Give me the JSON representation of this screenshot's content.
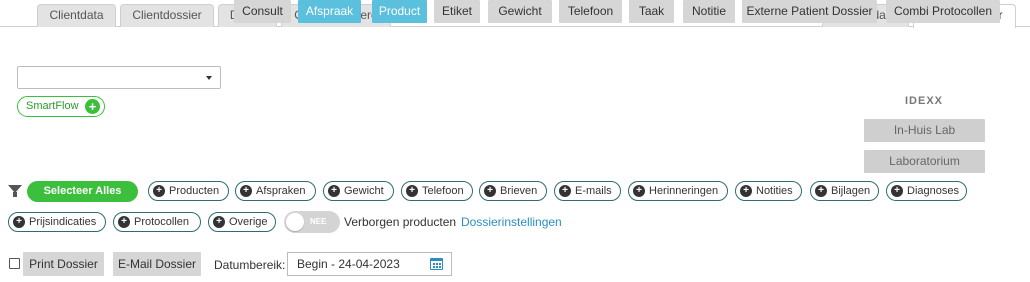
{
  "tabs_left": [
    "Clientdata",
    "Clientdossier",
    "Dieren",
    "Ongefactureerd"
  ],
  "tabs_right": [
    "Patientdata",
    "Patientdossier"
  ],
  "active_tab": "Patientdossier",
  "select": {
    "value": ""
  },
  "actions": {
    "consult": "Consult",
    "afspraak": "Afspraak",
    "product": "Product",
    "etiket": "Etiket",
    "gewicht": "Gewicht",
    "telefoon": "Telefoon",
    "taak": "Taak",
    "notitie": "Notitie",
    "externe": "Externe Patient Dossier",
    "combi": "Combi Protocollen"
  },
  "smartflow": "SmartFlow",
  "idexx": "IDEXX",
  "lab": {
    "inhuis": "In-Huis Lab",
    "laboratorium": "Laboratorium"
  },
  "filters": {
    "select_all": "Selecteer Alles",
    "producten": "Producten",
    "afspraken": "Afspraken",
    "gewicht": "Gewicht",
    "telefoon": "Telefoon",
    "brieven": "Brieven",
    "emails": "E-mails",
    "herinneringen": "Herinneringen",
    "notities": "Notities",
    "bijlagen": "Bijlagen",
    "diagnoses": "Diagnoses",
    "prijsindicaties": "Prijsindicaties",
    "protocollen": "Protocollen",
    "overige": "Overige"
  },
  "toggle": {
    "label": "NEE",
    "text": "Verborgen producten"
  },
  "dossier_settings": "Dossierinstellingen",
  "bottom": {
    "print": "Print Dossier",
    "email": "E-Mail Dossier",
    "date_label": "Datumbereik:",
    "date_value": "Begin - 24-04-2023"
  },
  "colors": {
    "blue": "#5bc0de",
    "green": "#3cbf3c",
    "link": "#2a8fc0"
  }
}
